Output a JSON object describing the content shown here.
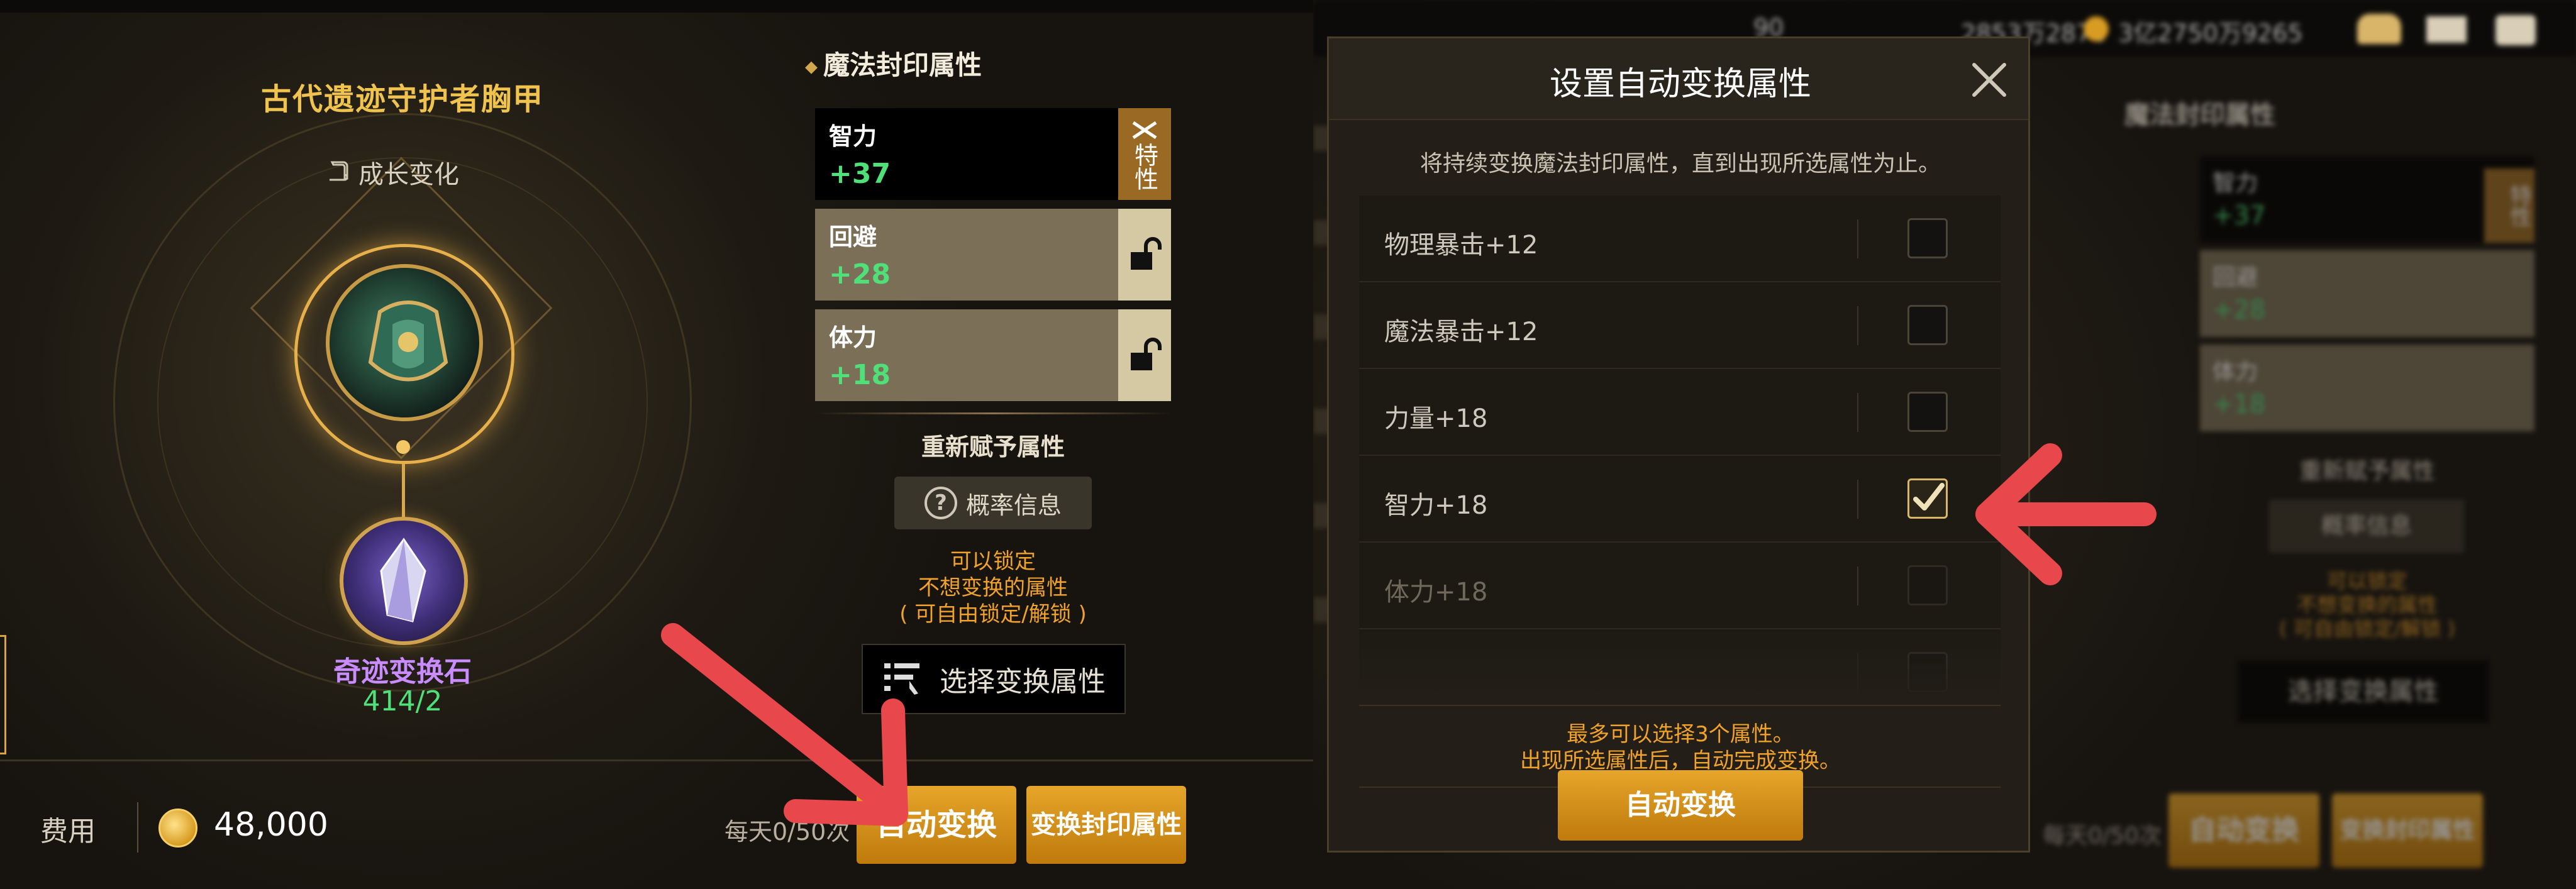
{
  "left_panel": {
    "item_title": "古代遗迹守护者胸甲",
    "growth_label": "成长变化",
    "material_name": "奇迹变换石",
    "material_count": "414/2",
    "section_title": "魔法封印属性",
    "attributes": [
      {
        "name": "智力",
        "value": "+37",
        "side": "特性",
        "locked": false
      },
      {
        "name": "回避",
        "value": "+28",
        "locked": true
      },
      {
        "name": "体力",
        "value": "+18",
        "locked": true
      }
    ],
    "reassign_label": "重新赋予属性",
    "probability_button": "概率信息",
    "lock_hint_1": "可以锁定",
    "lock_hint_2": "不想变换的属性",
    "lock_hint_3": "( 可自由锁定/解锁 )",
    "select_attr_button": "选择变换属性",
    "cost_label": "费用",
    "cost_value": "48,000",
    "daily_count": "每天0/50次",
    "auto_button": "自动变换",
    "transform_button": "变换封印属性"
  },
  "right_bg": {
    "topbar_values": [
      "90",
      "2853万2878",
      "3亿2750万9265"
    ],
    "section_title": "魔法封印属性",
    "attributes": [
      {
        "name": "智力",
        "value": "+37",
        "side": "特性"
      },
      {
        "name": "回避",
        "value": "+28"
      },
      {
        "name": "体力",
        "value": "+18"
      }
    ],
    "reassign_label": "重新赋予属性",
    "probability_button": "概率信息",
    "lock_hint_1": "可以锁定",
    "lock_hint_2": "不想变换的属性",
    "lock_hint_3": "( 可自由锁定/解锁 )",
    "select_attr_button": "选择变换属性",
    "daily_count": "每天0/50次",
    "auto_button": "自动变换",
    "transform_button": "变换封印属性"
  },
  "modal": {
    "title": "设置自动变换属性",
    "subtitle": "将持续变换魔法封印属性，直到出现所选属性为止。",
    "options": [
      {
        "label": "物理暴击+12",
        "checked": false
      },
      {
        "label": "魔法暴击+12",
        "checked": false
      },
      {
        "label": "力量+18",
        "checked": false
      },
      {
        "label": "智力+18",
        "checked": true
      },
      {
        "label": "体力+18",
        "checked": false
      }
    ],
    "note_1": "最多可以选择3个属性。",
    "note_2": "出现所选属性后，自动完成变换。",
    "confirm_button": "自动变换"
  },
  "colors": {
    "gold_title": "#f0c34e",
    "stat_green": "#4fe07a",
    "note_orange": "#f0a22a",
    "material_purple": "#c98cff",
    "arrow_red": "#e8474b",
    "button_gold": "#d8921b"
  }
}
